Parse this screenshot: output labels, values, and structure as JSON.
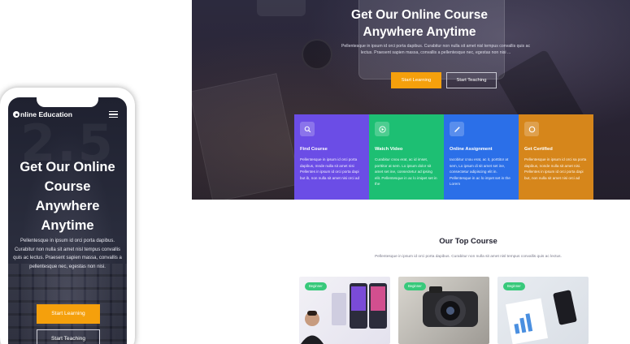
{
  "desktop": {
    "hero": {
      "title": "Get Our Online Course Anywhere Anytime",
      "description": "Pellentesque in ipsum id orci porta dapibus. Curabitur non nulla sit amet nisl tempus convallis quis ac lectus. Praesent sapien massa, convallis a pellentesque nec, egestas non nisi ...",
      "primary_button": "Start Learning",
      "secondary_button": "Start Teaching"
    },
    "features": [
      {
        "title": "Find Course",
        "icon": "search-icon",
        "color": "#6b4de6",
        "desc": "Pellentesque in ipsum id orci porta dapibus, mnde nulla sit amet nisi Pellentes in ipsum id orci porta dapi but ib, non nulla sit amet nisi orci ad"
      },
      {
        "title": "Watch Video",
        "icon": "play-icon",
        "color": "#1dbf73",
        "desc": "Curabitur cnou erat, ac id imset, porttitor at sem. Lo ipsum dolor sit amet set ine, consectetur ad ipsing elit. Pellentesque in ac lo imipet set in the"
      },
      {
        "title": "Online Assignment",
        "icon": "pencil-icon",
        "color": "#2b6fe8",
        "desc": "Iacobitur cnou erat, ac it, porttitor at sem, Lo ipsum di sit amet set ine, consectetur adipiscing elit in. Pellentesque in ac lo impet set in the Lorem"
      },
      {
        "title": "Get Certified",
        "icon": "certificate-icon",
        "color": "#d6861b",
        "desc": "Pellentesque in ipsum id orci sa porta dapibus, nonde nulla sit amet nisi. Pellentes in ipsum id orci porta dapi but, non nulla sit amet nisi orci ad"
      }
    ],
    "courses": {
      "title": "Our Top Course",
      "description": "Pellentesque in ipsum id orci porta dapibus. Curabitur non nulla sit amet nisl tempus convallis quis ac lectus.",
      "cards": [
        {
          "badge": "Beginner"
        },
        {
          "badge": "Beginner"
        },
        {
          "badge": "Beginner"
        }
      ]
    }
  },
  "mobile": {
    "logo_text": "nline Education",
    "hero": {
      "bg_digits": "2.5",
      "title": "Get Our Online Course Anywhere Anytime",
      "description": "Pellentesque in ipsum id orci porta dapibus. Curabitur non nulla sit amet nisl tempus convallis quis ac lectus. Praesent sapien massa, convallis a pellentesque nec, egestas non nisi.",
      "primary_button": "Start Learning",
      "secondary_button": "Start Teaching"
    }
  },
  "colors": {
    "accent": "#f5a00c",
    "badge": "#38c97b"
  }
}
